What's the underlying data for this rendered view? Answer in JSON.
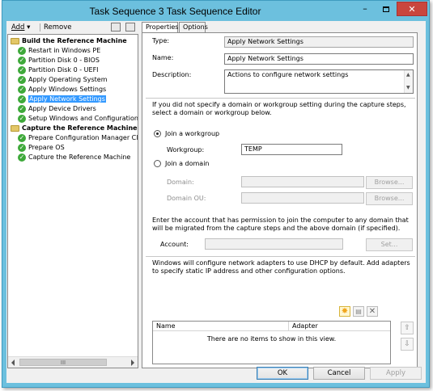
{
  "window": {
    "title": "Task Sequence 3 Task Sequence Editor",
    "controls": {
      "minimize": "–",
      "close": "✕"
    }
  },
  "toolbar": {
    "add_label": "Add",
    "add_arrow": "▾",
    "remove_label": "Remove"
  },
  "tree": {
    "groups": [
      {
        "label": "Build the Reference Machine",
        "steps": [
          "Restart in Windows PE",
          "Partition Disk 0 - BIOS",
          "Partition Disk 0 - UEFI",
          "Apply Operating System",
          "Apply Windows Settings",
          "Apply Network Settings",
          "Apply Device Drivers",
          "Setup Windows and Configuration"
        ]
      },
      {
        "label": "Capture the Reference Machine",
        "steps": [
          "Prepare Configuration Manager Cli",
          "Prepare OS",
          "Capture the Reference Machine"
        ]
      }
    ],
    "selected_step": "Apply Network Settings",
    "check_glyph": "✓",
    "scroll_grip": "III"
  },
  "tabs": {
    "properties": "Properties",
    "options": "Options"
  },
  "properties": {
    "type_label": "Type:",
    "type_value": "Apply Network Settings",
    "name_label": "Name:",
    "name_value": "Apply Network Settings",
    "description_label": "Description:",
    "description_value": "Actions to configure network settings",
    "domain_intro": "If you did not specify a domain or workgroup setting during the capture steps, select a domain or workgroup below.",
    "join_workgroup_label": "Join a workgroup",
    "workgroup_label": "Workgroup:",
    "workgroup_value": "TEMP",
    "join_domain_label": "Join a domain",
    "domain_label": "Domain:",
    "domain_ou_label": "Domain OU:",
    "browse_label": "Browse...",
    "account_intro": "Enter the account that has permission to join the computer to any domain that will be migrated from the capture steps and the above domain (if specified).",
    "account_label": "Account:",
    "set_label": "Set...",
    "adapters_intro": "Windows will configure network adapters to use DHCP by default. Add adapters to specify static IP address and other configuration options.",
    "list_columns": [
      "Name",
      "Adapter"
    ],
    "list_empty": "There are no items to show in this view."
  },
  "footer": {
    "ok_label": "OK",
    "cancel_label": "Cancel",
    "apply_label": "Apply"
  }
}
